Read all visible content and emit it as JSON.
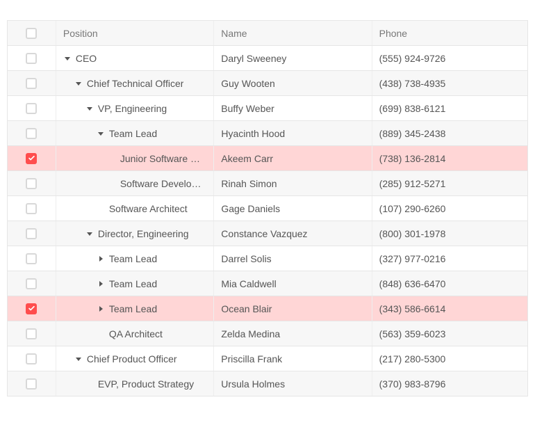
{
  "columns": {
    "position": "Position",
    "name": "Name",
    "phone": "Phone"
  },
  "rows": [
    {
      "position": "CEO",
      "name": "Daryl Sweeney",
      "phone": "(555) 924-9726",
      "level": 0,
      "expander": "expanded",
      "checked": false
    },
    {
      "position": "Chief Technical Officer",
      "name": "Guy Wooten",
      "phone": "(438) 738-4935",
      "level": 1,
      "expander": "expanded",
      "checked": false
    },
    {
      "position": "VP, Engineering",
      "name": "Buffy Weber",
      "phone": "(699) 838-6121",
      "level": 2,
      "expander": "expanded",
      "checked": false
    },
    {
      "position": "Team Lead",
      "name": "Hyacinth Hood",
      "phone": "(889) 345-2438",
      "level": 3,
      "expander": "expanded",
      "checked": false
    },
    {
      "position": "Junior Software …",
      "name": "Akeem Carr",
      "phone": "(738) 136-2814",
      "level": 4,
      "expander": "none",
      "checked": true
    },
    {
      "position": "Software Develo…",
      "name": "Rinah Simon",
      "phone": "(285) 912-5271",
      "level": 4,
      "expander": "none",
      "checked": false
    },
    {
      "position": "Software Architect",
      "name": "Gage Daniels",
      "phone": "(107) 290-6260",
      "level": 3,
      "expander": "none",
      "checked": false
    },
    {
      "position": "Director, Engineering",
      "name": "Constance Vazquez",
      "phone": "(800) 301-1978",
      "level": 2,
      "expander": "expanded",
      "checked": false
    },
    {
      "position": "Team Lead",
      "name": "Darrel Solis",
      "phone": "(327) 977-0216",
      "level": 3,
      "expander": "collapsed",
      "checked": false
    },
    {
      "position": "Team Lead",
      "name": "Mia Caldwell",
      "phone": "(848) 636-6470",
      "level": 3,
      "expander": "collapsed",
      "checked": false
    },
    {
      "position": "Team Lead",
      "name": "Ocean Blair",
      "phone": "(343) 586-6614",
      "level": 3,
      "expander": "collapsed",
      "checked": true
    },
    {
      "position": "QA Architect",
      "name": "Zelda Medina",
      "phone": "(563) 359-6023",
      "level": 3,
      "expander": "none",
      "checked": false
    },
    {
      "position": "Chief Product Officer",
      "name": "Priscilla Frank",
      "phone": "(217) 280-5300",
      "level": 1,
      "expander": "expanded",
      "checked": false
    },
    {
      "position": "EVP, Product Strategy",
      "name": "Ursula Holmes",
      "phone": "(370) 983-8796",
      "level": 2,
      "expander": "none",
      "checked": false
    }
  ]
}
